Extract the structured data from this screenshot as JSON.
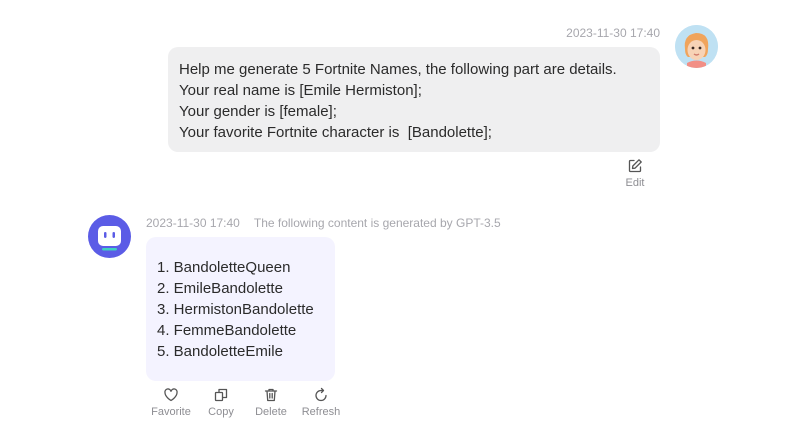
{
  "user_message": {
    "timestamp": "2023-11-30 17:40",
    "lines": [
      "Help me generate 5 Fortnite Names, the following part are details.",
      "Your real name is [Emile Hermiston];",
      "Your gender is [female];",
      "Your favorite Fortnite character is  [Bandolette];"
    ],
    "edit_label": "Edit"
  },
  "bot_message": {
    "timestamp": "2023-11-30 17:40",
    "generated_note": "The following content is generated by GPT-3.5",
    "lines": [
      "1. BandoletteQueen",
      "2. EmileBandolette",
      "3. HermistonBandolette",
      "4. FemmeBandolette",
      "5. BandoletteEmile"
    ],
    "actions": {
      "favorite": "Favorite",
      "copy": "Copy",
      "delete": "Delete",
      "refresh": "Refresh"
    }
  },
  "icons": {
    "edit": "edit-icon",
    "favorite": "heart-icon",
    "copy": "copy-icon",
    "delete": "trash-icon",
    "refresh": "refresh-icon"
  },
  "colors": {
    "user_bubble": "#efeff0",
    "bot_bubble": "#f4f3ff",
    "bot_avatar": "#5b5ce6",
    "timestamp": "#a7a7ad",
    "action_label": "#8e8e93"
  }
}
